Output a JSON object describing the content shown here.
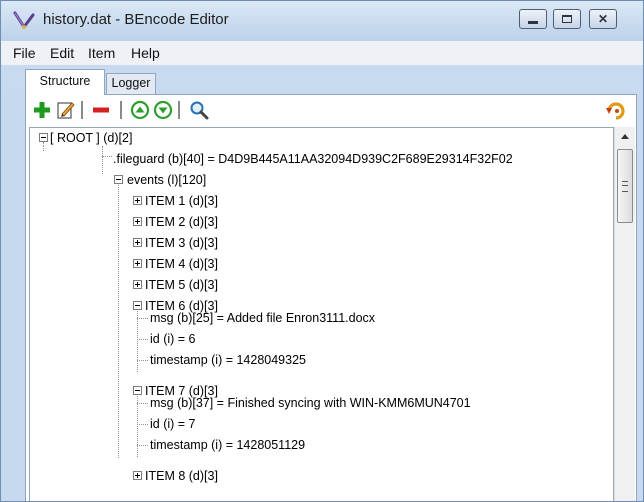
{
  "window": {
    "title": "history.dat - BEncode Editor",
    "icon": "bencode-app-icon",
    "controls": {
      "close_glyph": "✕"
    }
  },
  "menu": {
    "file": "File",
    "edit": "Edit",
    "item": "Item",
    "help": "Help"
  },
  "tabs": {
    "structure": "Structure",
    "logger": "Logger"
  },
  "toolbar": {
    "icons": [
      "add-icon",
      "edit-icon",
      "remove-icon",
      "move-up-icon",
      "move-down-icon",
      "find-icon",
      "undo-icon"
    ]
  },
  "tree": {
    "root": "[ ROOT ] (d)[2]",
    "fileguard": ".fileguard (b)[40] = D4D9B445A11AA32094D939C2F689E29314F32F02",
    "events": "events (l)[120]",
    "item1": "ITEM 1 (d)[3]",
    "item2": "ITEM 2 (d)[3]",
    "item3": "ITEM 3 (d)[3]",
    "item4": "ITEM 4 (d)[3]",
    "item5": "ITEM 5 (d)[3]",
    "item6": "ITEM 6 (d)[3]",
    "item6_msg": "msg (b)[25] = Added file Enron3111.docx",
    "item6_id": "id (i) = 6",
    "item6_timestamp": "timestamp (i) = 1428049325",
    "item7": "ITEM 7 (d)[3]",
    "item7_msg": "msg (b)[37] = Finished syncing with WIN-KMM6MUN4701",
    "item7_id": "id (i) = 7",
    "item7_timestamp": "timestamp (i) = 1428051129",
    "item8": "ITEM 8 (d)[3]"
  },
  "colors": {
    "add": "#1e9a1e",
    "remove": "#d42020",
    "arrows": "#2f9e2f",
    "title_bar": "#c9daef"
  }
}
